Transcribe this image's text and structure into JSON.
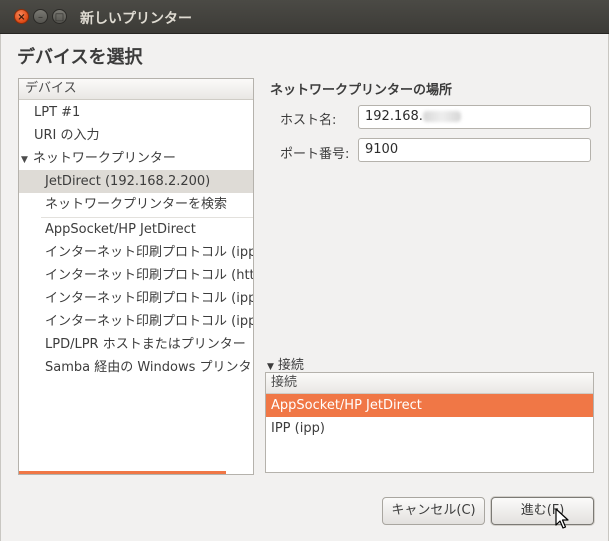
{
  "window": {
    "title": "新しいプリンター",
    "close_glyph": "×",
    "minimize_glyph": "–",
    "maximize_glyph": "□"
  },
  "heading": "デバイスを選択",
  "device_tree": {
    "header": "デバイス",
    "items": [
      {
        "label": "LPT #1"
      },
      {
        "label": "URI の入力"
      },
      {
        "label": "ネットワークプリンター",
        "expanded": true
      },
      {
        "label": "JetDirect (192.168.2.200)",
        "selected": true
      },
      {
        "label": "ネットワークプリンターを検索"
      },
      {
        "label": "AppSocket/HP JetDirect"
      },
      {
        "label": "インターネット印刷プロトコル (ipp"
      },
      {
        "label": "インターネット印刷プロトコル (htt"
      },
      {
        "label": "インターネット印刷プロトコル (ipp"
      },
      {
        "label": "インターネット印刷プロトコル (ipp"
      },
      {
        "label": "LPD/LPR ホストまたはプリンター"
      },
      {
        "label": "Samba 経由の Windows プリンタ"
      }
    ],
    "expander_glyph": "▼"
  },
  "network_location": {
    "title": "ネットワークプリンターの場所",
    "host_label": "ホスト名:",
    "host_value": "192.168.",
    "port_label": "ポート番号:",
    "port_value": "9100"
  },
  "connection": {
    "expander_label": "接続",
    "expander_glyph": "▼",
    "header": "接続",
    "items": [
      {
        "label": "AppSocket/HP JetDirect",
        "selected": true
      },
      {
        "label": "IPP (ipp)"
      }
    ]
  },
  "buttons": {
    "cancel": "キャンセル(C)",
    "forward": "進む(F)"
  },
  "colors": {
    "accent": "#f07746",
    "title_bar": "#3c3b37",
    "window_bg": "#f2f1f0",
    "selection_gray": "#dedbd6"
  }
}
